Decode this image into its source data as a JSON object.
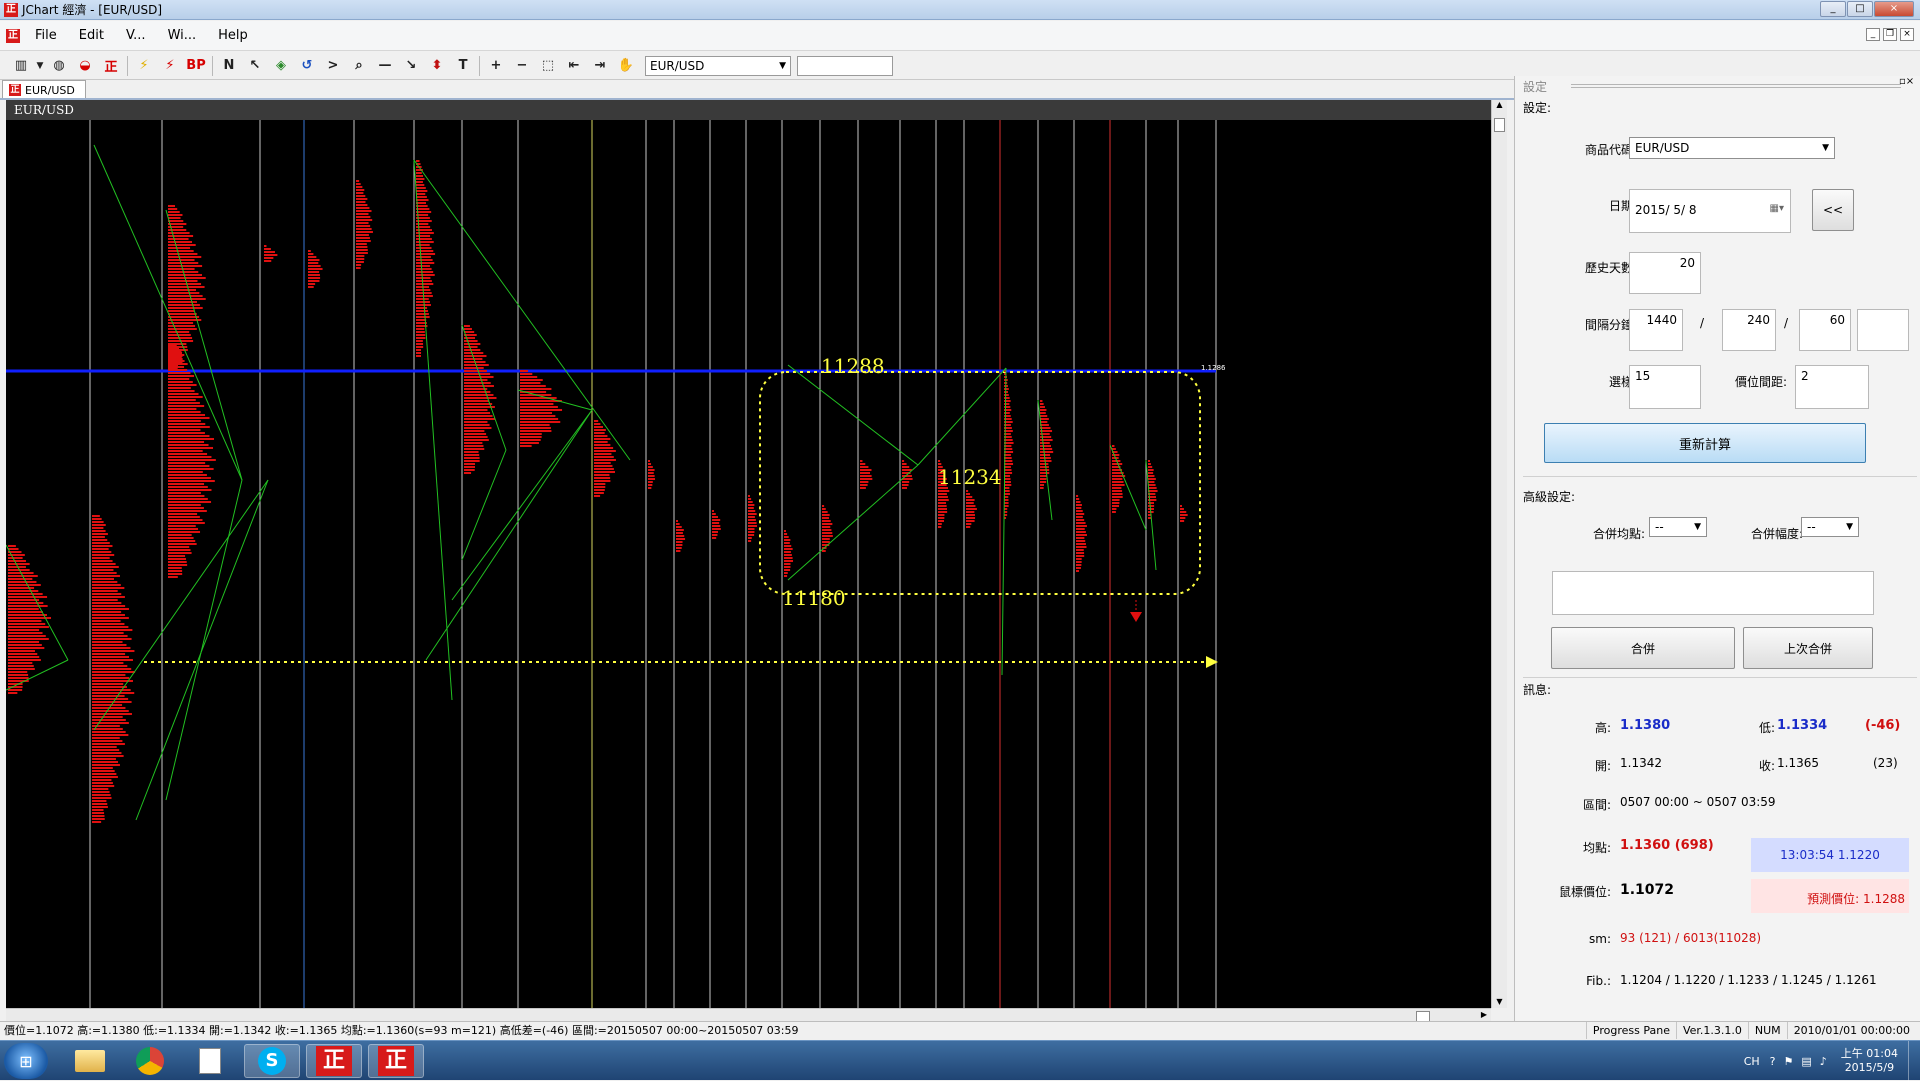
{
  "window": {
    "title": "JChart 經濟 - [EUR/USD]",
    "controls": [
      "_",
      "□",
      "×"
    ]
  },
  "menu": {
    "items": [
      "File",
      "Edit",
      "V...",
      "Wi...",
      "Help"
    ],
    "mdi_controls": [
      "_",
      "❐",
      "×"
    ]
  },
  "toolbar": {
    "icons": [
      "chart-icon",
      "pie-icon",
      "car-icon",
      "zheng-icon",
      "lightning-icon",
      "lightning-red-icon",
      "bp-text",
      "n-icon",
      "cursor-icon",
      "layers-icon",
      "undo-icon",
      "arrow-icon",
      "zoom-icon",
      "hline-icon",
      "diag-icon",
      "updown-icon",
      "text-icon",
      "plus-icon",
      "minus-icon",
      "select-icon",
      "left-icon",
      "right-icon",
      "hand-icon"
    ],
    "bp_label": "BP",
    "symbol": "EUR/USD"
  },
  "tab": {
    "label": "EUR/USD"
  },
  "chart": {
    "label": "EUR/USD",
    "annotations": [
      "11288",
      "11234",
      "11180"
    ],
    "blue_line_price": "1.1286",
    "colors": {
      "background": "#000000",
      "profile": "#e01010",
      "connector": "#22c022",
      "level": "#1020ff",
      "yellow": "#ffff40"
    }
  },
  "panel": {
    "title": "設定",
    "settings_label": "設定:",
    "product_code_label": "商品代碼:",
    "product_code_value": "EUR/USD",
    "date_label": "日期:",
    "date_value": "2015/ 5/ 8",
    "back_button": "<<",
    "history_days_label": "歷史天數:",
    "history_days_value": "20",
    "interval_label": "間隔分鐘:",
    "interval_1": "1440",
    "interval_2": "240",
    "interval_3": "60",
    "interval_4": "",
    "slash": "/",
    "select_label": "選樣:",
    "select_value": "15",
    "tick_label": "價位間距:",
    "tick_value": "2",
    "recalc_button": "重新計算",
    "advanced_label": "高級設定:",
    "merge_avg_label": "合併均點:",
    "merge_avg_value": "--",
    "merge_range_label": "合併幅度:",
    "merge_range_value": "--",
    "merge_button": "合併",
    "last_merge_button": "上次合併",
    "info_label": "訊息:",
    "high_label": "高:",
    "high_value": "1.1380",
    "low_label": "低:",
    "low_value": "1.1334",
    "diff_value": "(-46)",
    "open_label": "開:",
    "open_value": "1.1342",
    "close_label": "收:",
    "close_value": "1.1365",
    "close_count": "(23)",
    "range_label": "區間:",
    "range_value": "0507 00:00 ~ 0507 03:59",
    "avg_label": "均點:",
    "avg_value": "1.1360 (698)",
    "time_price": "13:03:54  1.1220",
    "mouse_label": "鼠標價位:",
    "mouse_value": "1.1072",
    "predict_value": "預測價位: 1.1288",
    "sm_label": "sm:",
    "sm_value": "93 (121) / 6013(11028)",
    "fib_label": "Fib.:",
    "fib_value": "1.1204 / 1.1220 / 1.1233 / 1.1245 / 1.1261"
  },
  "status": {
    "left": "價位=1.1072  高:=1.1380  低:=1.1334  開:=1.1342  收:=1.1365  均點:=1.1360(s=93 m=121)  高低差=(-46)  區間:=20150507 00:00~20150507 03:59",
    "progress": "Progress Pane",
    "version": "Ver.1.3.1.0",
    "num": "NUM",
    "datetime": "2010/01/01 00:00:00"
  },
  "taskbar": {
    "apps": [
      "windows-start",
      "explorer",
      "chrome",
      "notepad",
      "skype",
      "jchart-1",
      "jchart-2"
    ],
    "lang": "CH",
    "time": "上午 01:04",
    "date": "2015/5/9"
  }
}
